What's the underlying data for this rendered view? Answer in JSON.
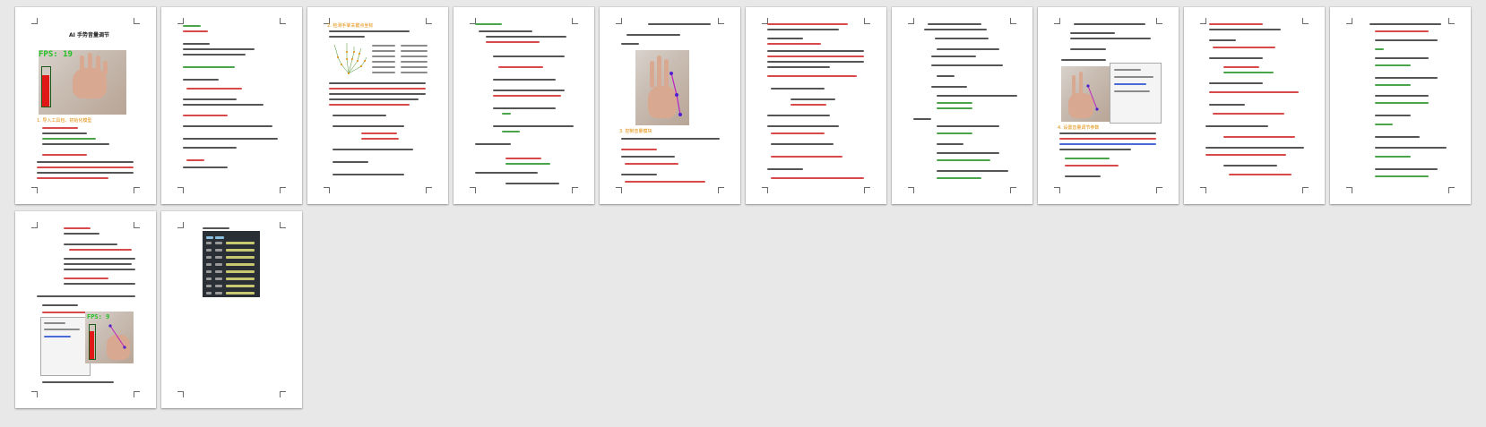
{
  "viewer": {
    "mode": "multi-page-thumbnail-view",
    "page_count": 12
  },
  "pages": [
    {
      "number": 1,
      "title": "AI 手势音量调节",
      "fps": "FPS: 19",
      "section_heading": "1. 导入工具包、初始化模型"
    },
    {
      "number": 2
    },
    {
      "number": 3,
      "section_heading": "2. 检测手掌关键点坐标"
    },
    {
      "number": 4
    },
    {
      "number": 5,
      "section_heading": "3. 控制音量模块"
    },
    {
      "number": 6
    },
    {
      "number": 7
    },
    {
      "number": 8,
      "section_heading": "4. 设置音量调节参数"
    },
    {
      "number": 9
    },
    {
      "number": 10
    },
    {
      "number": 11,
      "fps": "FPS: 9"
    },
    {
      "number": 12
    }
  ],
  "colors": {
    "background": "#e8e8e8",
    "page": "#ffffff",
    "heading": "#e08a00",
    "fps_text": "#22c022",
    "volume_bar": "#e01818",
    "squiggle_red": "#d84a4a",
    "squiggle_green": "#4aa54a",
    "terminal_bg": "#2a2f35"
  }
}
